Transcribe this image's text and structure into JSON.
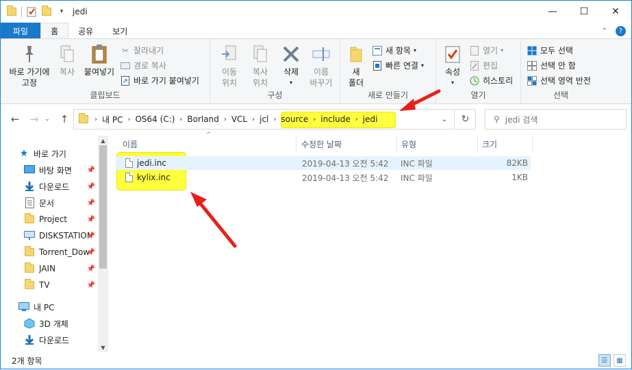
{
  "window": {
    "title": "jedi",
    "minimize_glyph": "—",
    "maximize_glyph": "☐",
    "close_glyph": "✕"
  },
  "tabs": {
    "file": "파일",
    "home": "홈",
    "share": "공유",
    "view": "보기"
  },
  "ribbon": {
    "clipboard": {
      "name": "클립보드",
      "pin_line1": "바로 가기에",
      "pin_line2": "고정",
      "copy": "복사",
      "paste": "붙여넣기",
      "cut": "잘라내기",
      "copy_path": "경로 복사",
      "paste_shortcut": "바로 가기 붙여넣기"
    },
    "organize": {
      "name": "구성",
      "move_line1": "이동",
      "move_line2": "위치",
      "copyto_line1": "복사",
      "copyto_line2": "위치",
      "delete": "삭제",
      "rename_line1": "이름",
      "rename_line2": "바꾸기"
    },
    "new": {
      "name": "새로 만들기",
      "folder_line1": "새",
      "folder_line2": "폴더",
      "new_item": "새 항목",
      "easy_access": "빠른 연결"
    },
    "open": {
      "name": "열기",
      "properties": "속성",
      "open": "열기",
      "edit": "편집",
      "history": "히스토리"
    },
    "select": {
      "name": "선택",
      "select_all": "모두 선택",
      "select_none": "선택 안 함",
      "invert": "선택 영역 반전"
    }
  },
  "address": {
    "crumbs": [
      "내 PC",
      "OS64 (C:)",
      "Borland",
      "VCL",
      "jcl",
      "source",
      "include",
      "jedi"
    ],
    "search_placeholder": "jedi 검색"
  },
  "nav": {
    "quick_access": "바로 가기",
    "items": [
      {
        "label": "바탕 화면",
        "icon": "desktop-icon",
        "pinned": true
      },
      {
        "label": "다운로드",
        "icon": "download-icon",
        "pinned": true
      },
      {
        "label": "문서",
        "icon": "document-icon",
        "pinned": true
      },
      {
        "label": "Project",
        "icon": "folder-icon",
        "pinned": true
      },
      {
        "label": "DISKSTATION",
        "icon": "network-drive-icon",
        "pinned": true
      },
      {
        "label": "Torrent_Downl",
        "icon": "folder-icon",
        "pinned": true
      },
      {
        "label": "JAIN",
        "icon": "folder-icon",
        "pinned": true
      },
      {
        "label": "TV",
        "icon": "folder-icon",
        "pinned": true
      }
    ],
    "this_pc": "내 PC",
    "pc_items": [
      {
        "label": "3D 개체",
        "icon": "3d-objects-icon"
      },
      {
        "label": "다운로드",
        "icon": "download-icon"
      }
    ]
  },
  "columns": {
    "name": "이름",
    "modified": "수정한 날짜",
    "type": "유형",
    "size": "크기"
  },
  "files": [
    {
      "name": "jedi.inc",
      "modified": "2019-04-13 오전 5:42",
      "type": "INC 파일",
      "size": "82KB",
      "selected": true
    },
    {
      "name": "kylix.inc",
      "modified": "2019-04-13 오전 5:42",
      "type": "INC 파일",
      "size": "1KB",
      "selected": false
    }
  ],
  "status": {
    "count": "2개 항목"
  },
  "colors": {
    "accent": "#1979ca",
    "highlight": "#ffff3e",
    "arrow": "#e8201a",
    "selection": "#e5f3ff"
  }
}
